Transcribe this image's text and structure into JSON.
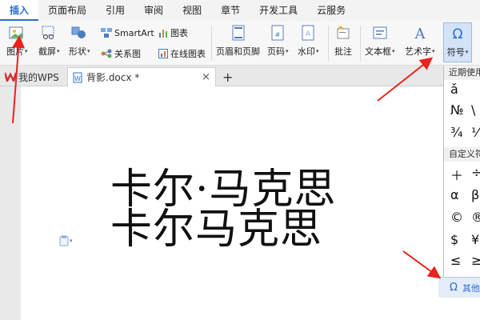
{
  "menu_tabs": [
    "插入",
    "页面布局",
    "引用",
    "审阅",
    "视图",
    "章节",
    "开发工具",
    "云服务"
  ],
  "ribbon": {
    "picture": "图片",
    "screenshot": "截屏",
    "shapes": "形状",
    "smartart": "SmartArt",
    "relation": "关系图",
    "chart": "图表",
    "online_chart": "在线图表",
    "header_footer": "页眉和页脚",
    "page_number": "页码",
    "watermark": "水印",
    "comment": "批注",
    "textbox": "文本框",
    "wordart": "艺术字",
    "symbol": "符号"
  },
  "doc_tabs": {
    "home": "我的WPS",
    "active_doc": "背影.docx *",
    "close": "×",
    "new_tab": "+"
  },
  "document": {
    "line1": "卡尔·马克思",
    "line2": "卡尔马克思"
  },
  "symbol_panel": {
    "recent_label": "近期使用",
    "recent_symbols": [
      "ǎ",
      "№",
      "\\",
      "¾",
      "⅟"
    ],
    "custom_label": "自定义符",
    "custom_symbols": [
      "＋",
      "÷",
      "α",
      "β",
      "©",
      "®",
      "$",
      "¥",
      "≤",
      "≥"
    ],
    "more_label": "其他符号"
  },
  "colors": {
    "accent": "#2b6cd3",
    "arrow": "#e8231c"
  }
}
